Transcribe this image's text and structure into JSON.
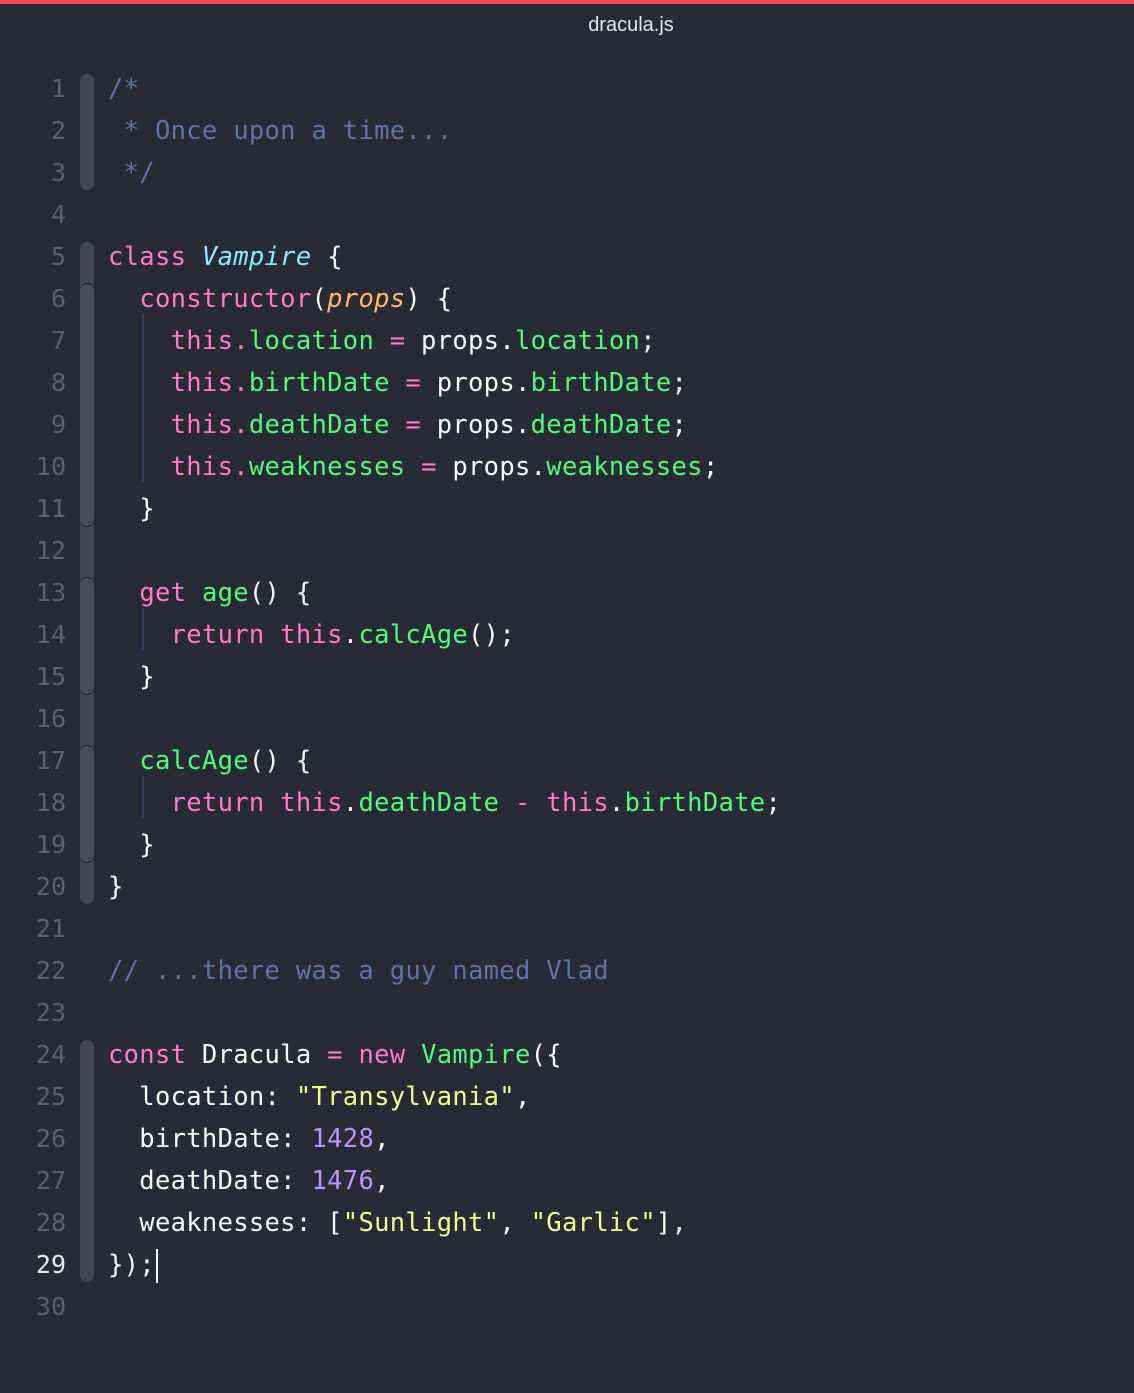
{
  "window": {
    "title": "dracula.js",
    "accent_color": "#ff4a54"
  },
  "editor": {
    "active_line": 29,
    "cursor": {
      "line": 29,
      "after_text": "});"
    },
    "theme_colors": {
      "background": "#282a36",
      "comment": "#6272a4",
      "keyword": "#ff79c6",
      "class": "#8be9fd",
      "function": "#50fa7b",
      "parameter": "#ffb86c",
      "string": "#f1fa8c",
      "number": "#bd93f9",
      "foreground": "#f8f8f2"
    },
    "lines": [
      {
        "n": "1",
        "tokens": [
          [
            "comment",
            "/*"
          ]
        ]
      },
      {
        "n": "2",
        "tokens": [
          [
            "comment",
            " * Once upon a time..."
          ]
        ]
      },
      {
        "n": "3",
        "tokens": [
          [
            "comment",
            " */"
          ]
        ]
      },
      {
        "n": "4",
        "tokens": []
      },
      {
        "n": "5",
        "tokens": [
          [
            "keyword",
            "class"
          ],
          [
            "plain",
            " "
          ],
          [
            "class",
            "Vampire"
          ],
          [
            "plain",
            " {"
          ]
        ]
      },
      {
        "n": "6",
        "tokens": [
          [
            "plain",
            "  "
          ],
          [
            "keyword",
            "constructor"
          ],
          [
            "plain",
            "("
          ],
          [
            "param",
            "props"
          ],
          [
            "plain",
            ") {"
          ]
        ]
      },
      {
        "n": "7",
        "tokens": [
          [
            "plain",
            "    "
          ],
          [
            "keyword",
            "this"
          ],
          [
            "keyword",
            "."
          ],
          [
            "prop",
            "location"
          ],
          [
            "plain",
            " "
          ],
          [
            "op",
            "="
          ],
          [
            "plain",
            " props."
          ],
          [
            "prop",
            "location"
          ],
          [
            "plain",
            ";"
          ]
        ]
      },
      {
        "n": "8",
        "tokens": [
          [
            "plain",
            "    "
          ],
          [
            "keyword",
            "this"
          ],
          [
            "keyword",
            "."
          ],
          [
            "prop",
            "birthDate"
          ],
          [
            "plain",
            " "
          ],
          [
            "op",
            "="
          ],
          [
            "plain",
            " props."
          ],
          [
            "prop",
            "birthDate"
          ],
          [
            "plain",
            ";"
          ]
        ]
      },
      {
        "n": "9",
        "tokens": [
          [
            "plain",
            "    "
          ],
          [
            "keyword",
            "this"
          ],
          [
            "keyword",
            "."
          ],
          [
            "prop",
            "deathDate"
          ],
          [
            "plain",
            " "
          ],
          [
            "op",
            "="
          ],
          [
            "plain",
            " props."
          ],
          [
            "prop",
            "deathDate"
          ],
          [
            "plain",
            ";"
          ]
        ]
      },
      {
        "n": "10",
        "tokens": [
          [
            "plain",
            "    "
          ],
          [
            "keyword",
            "this"
          ],
          [
            "keyword",
            "."
          ],
          [
            "prop",
            "weaknesses"
          ],
          [
            "plain",
            " "
          ],
          [
            "op",
            "="
          ],
          [
            "plain",
            " props."
          ],
          [
            "prop",
            "weaknesses"
          ],
          [
            "plain",
            ";"
          ]
        ]
      },
      {
        "n": "11",
        "tokens": [
          [
            "plain",
            "  }"
          ]
        ]
      },
      {
        "n": "12",
        "tokens": []
      },
      {
        "n": "13",
        "tokens": [
          [
            "plain",
            "  "
          ],
          [
            "keyword",
            "get"
          ],
          [
            "plain",
            " "
          ],
          [
            "func",
            "age"
          ],
          [
            "plain",
            "() {"
          ]
        ]
      },
      {
        "n": "14",
        "tokens": [
          [
            "plain",
            "    "
          ],
          [
            "keyword",
            "return"
          ],
          [
            "plain",
            " "
          ],
          [
            "keyword",
            "this"
          ],
          [
            "plain",
            "."
          ],
          [
            "func",
            "calcAge"
          ],
          [
            "plain",
            "();"
          ]
        ]
      },
      {
        "n": "15",
        "tokens": [
          [
            "plain",
            "  }"
          ]
        ]
      },
      {
        "n": "16",
        "tokens": []
      },
      {
        "n": "17",
        "tokens": [
          [
            "plain",
            "  "
          ],
          [
            "func",
            "calcAge"
          ],
          [
            "plain",
            "() {"
          ]
        ]
      },
      {
        "n": "18",
        "tokens": [
          [
            "plain",
            "    "
          ],
          [
            "keyword",
            "return"
          ],
          [
            "plain",
            " "
          ],
          [
            "keyword",
            "this"
          ],
          [
            "plain",
            "."
          ],
          [
            "prop",
            "deathDate"
          ],
          [
            "plain",
            " "
          ],
          [
            "op",
            "-"
          ],
          [
            "plain",
            " "
          ],
          [
            "keyword",
            "this"
          ],
          [
            "plain",
            "."
          ],
          [
            "prop",
            "birthDate"
          ],
          [
            "plain",
            ";"
          ]
        ]
      },
      {
        "n": "19",
        "tokens": [
          [
            "plain",
            "  }"
          ]
        ]
      },
      {
        "n": "20",
        "tokens": [
          [
            "plain",
            "}"
          ]
        ]
      },
      {
        "n": "21",
        "tokens": []
      },
      {
        "n": "22",
        "tokens": [
          [
            "comment",
            "// ...there was a guy named Vlad"
          ]
        ]
      },
      {
        "n": "23",
        "tokens": []
      },
      {
        "n": "24",
        "tokens": [
          [
            "keyword",
            "const"
          ],
          [
            "plain",
            " Dracula "
          ],
          [
            "op",
            "="
          ],
          [
            "plain",
            " "
          ],
          [
            "keyword",
            "new"
          ],
          [
            "plain",
            " "
          ],
          [
            "func",
            "Vampire"
          ],
          [
            "plain",
            "({"
          ]
        ]
      },
      {
        "n": "25",
        "tokens": [
          [
            "plain",
            "  location: "
          ],
          [
            "string",
            "\"Transylvania\""
          ],
          [
            "plain",
            ","
          ]
        ]
      },
      {
        "n": "26",
        "tokens": [
          [
            "plain",
            "  birthDate: "
          ],
          [
            "number",
            "1428"
          ],
          [
            "plain",
            ","
          ]
        ]
      },
      {
        "n": "27",
        "tokens": [
          [
            "plain",
            "  deathDate: "
          ],
          [
            "number",
            "1476"
          ],
          [
            "plain",
            ","
          ]
        ]
      },
      {
        "n": "28",
        "tokens": [
          [
            "plain",
            "  weaknesses: ["
          ],
          [
            "string",
            "\"Sunlight\""
          ],
          [
            "plain",
            ", "
          ],
          [
            "string",
            "\"Garlic\""
          ],
          [
            "plain",
            "],"
          ]
        ]
      },
      {
        "n": "29",
        "tokens": [
          [
            "plain",
            "});"
          ]
        ]
      },
      {
        "n": "30",
        "tokens": []
      }
    ]
  }
}
